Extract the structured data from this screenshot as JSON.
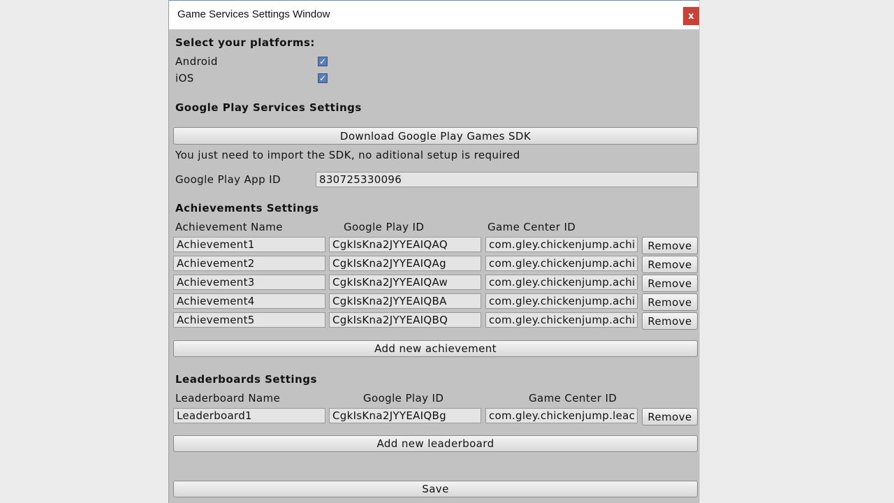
{
  "window": {
    "title": "Game Services Settings Window",
    "close_label": "x"
  },
  "platforms": {
    "heading": "Select your platforms:",
    "items": [
      {
        "label": "Android",
        "checked": true
      },
      {
        "label": "iOS",
        "checked": true
      }
    ]
  },
  "google_play": {
    "heading": "Google Play Services Settings",
    "download_label": "Download Google Play Games SDK",
    "note": "You just need to import the SDK, no aditional setup is required",
    "app_id_label": "Google Play App ID",
    "app_id_value": "830725330096"
  },
  "achievements": {
    "heading": "Achievements Settings",
    "columns": [
      "Achievement Name",
      "Google Play ID",
      "Game Center ID"
    ],
    "rows": [
      {
        "name": "Achievement1",
        "gp_id": "CgkIsKna2JYYEAIQAQ",
        "gc_id": "com.gley.chickenjump.achi"
      },
      {
        "name": "Achievement2",
        "gp_id": "CgkIsKna2JYYEAIQAg",
        "gc_id": "com.gley.chickenjump.achi"
      },
      {
        "name": "Achievement3",
        "gp_id": "CgkIsKna2JYYEAIQAw",
        "gc_id": "com.gley.chickenjump.achi"
      },
      {
        "name": "Achievement4",
        "gp_id": "CgkIsKna2JYYEAIQBA",
        "gc_id": "com.gley.chickenjump.achi"
      },
      {
        "name": "Achievement5",
        "gp_id": "CgkIsKna2JYYEAIQBQ",
        "gc_id": "com.gley.chickenjump.achi"
      }
    ],
    "remove_label": "Remove",
    "add_label": "Add new achievement"
  },
  "leaderboards": {
    "heading": "Leaderboards Settings",
    "columns": [
      "Leaderboard Name",
      "Google Play ID",
      "Game Center ID"
    ],
    "rows": [
      {
        "name": "Leaderboard1",
        "gp_id": "CgkIsKna2JYYEAIQBg",
        "gc_id": "com.gley.chickenjump.leac"
      }
    ],
    "remove_label": "Remove",
    "add_label": "Add new leaderboard"
  },
  "save_label": "Save",
  "icons": {
    "checkbox": "checkmark-icon",
    "close": "close-icon"
  },
  "colors": {
    "panel": "#c2c2c2",
    "checkbox": "#5a7db8",
    "close": "#c9423a"
  }
}
